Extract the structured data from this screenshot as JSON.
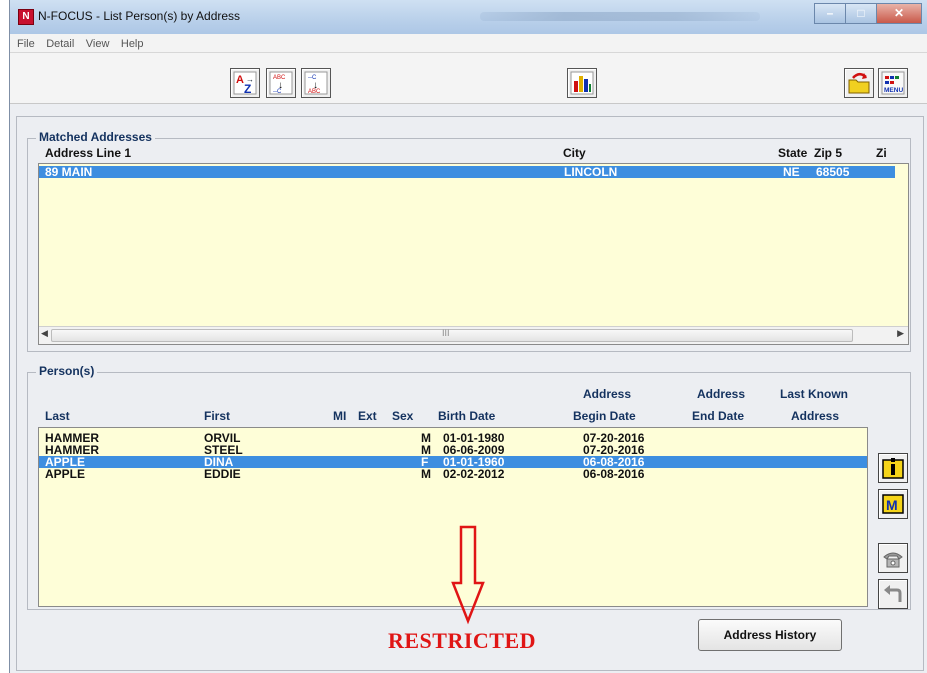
{
  "window": {
    "app_icon_letter": "N",
    "title": "N-FOCUS - List Person(s) by Address"
  },
  "menu": [
    "File",
    "Detail",
    "View",
    "Help"
  ],
  "toolbar": {
    "buttons": [
      "sort-az-icon",
      "sort-ascending-icon",
      "sort-descending-icon",
      "chart-icon",
      "folder-return-icon",
      "menu-icon"
    ],
    "menu_icon_label": "MENU"
  },
  "matched_addresses": {
    "legend": "Matched Addresses",
    "columns": {
      "address": "Address Line 1",
      "city": "City",
      "state": "State",
      "zip5": "Zip 5",
      "zip4": "Zi"
    },
    "rows": [
      {
        "address": "89 MAIN",
        "city": "LINCOLN",
        "state": "NE",
        "zip5": "68505",
        "selected": true
      }
    ],
    "scroll_center": "III"
  },
  "persons": {
    "legend": "Person(s)",
    "columns": {
      "last": "Last",
      "first": "First",
      "mi": "MI",
      "ext": "Ext",
      "sex": "Sex",
      "birth": "Birth Date",
      "begin_top": "Address",
      "begin_bottom": "Begin Date",
      "end_top": "Address",
      "end_bottom": "End Date",
      "known_top": "Last Known",
      "known_bottom": "Address"
    },
    "rows": [
      {
        "last": "HAMMER",
        "first": "ORVIL",
        "sex": "M",
        "birth": "01-01-1980",
        "begin": "07-20-2016",
        "selected": false
      },
      {
        "last": "HAMMER",
        "first": "STEEL",
        "sex": "M",
        "birth": "06-06-2009",
        "begin": "07-20-2016",
        "selected": false
      },
      {
        "last": "APPLE",
        "first": "DINA",
        "sex": "F",
        "birth": "01-01-1960",
        "begin": "06-08-2016",
        "selected": true
      },
      {
        "last": "APPLE",
        "first": "EDDIE",
        "sex": "M",
        "birth": "02-02-2012",
        "begin": "06-08-2016",
        "selected": false
      }
    ],
    "side_buttons": [
      "info-icon",
      "m-icon",
      "phone-icon",
      "back-arrow-icon"
    ]
  },
  "annotation": {
    "text": "RESTRICTED",
    "color": "#e01515"
  },
  "address_history_label": "Address History",
  "colors": {
    "list_bg": "#fefed8",
    "selection": "#3d8ee0",
    "header_blue": "#14325f"
  }
}
